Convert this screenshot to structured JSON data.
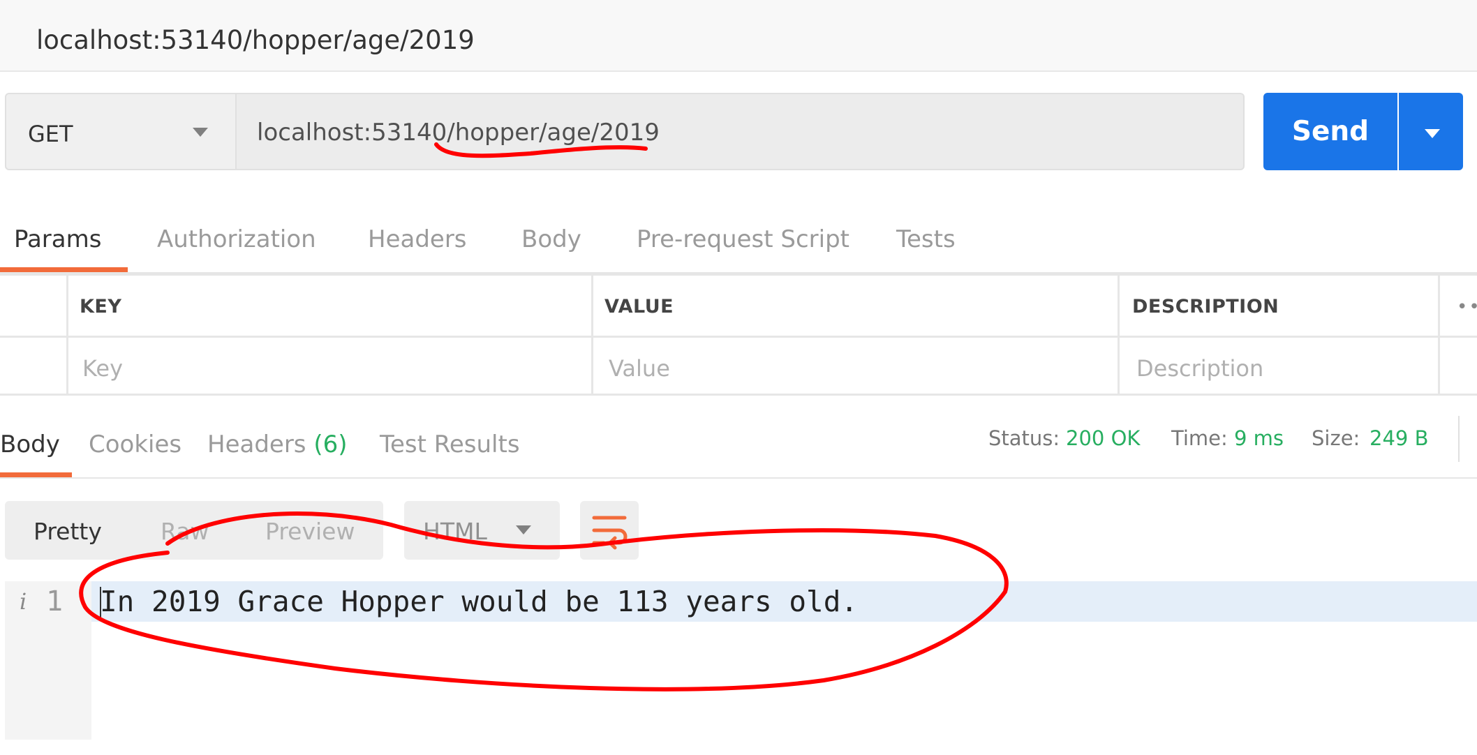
{
  "request": {
    "title": "localhost:53140/hopper/age/2019",
    "method": "GET",
    "url": "localhost:53140/hopper/age/2019",
    "send_label": "Send"
  },
  "request_tabs": [
    "Params",
    "Authorization",
    "Headers",
    "Body",
    "Pre-request Script",
    "Tests"
  ],
  "params_table": {
    "columns": [
      "KEY",
      "VALUE",
      "DESCRIPTION"
    ],
    "placeholders": [
      "Key",
      "Value",
      "Description"
    ],
    "more_label": "••"
  },
  "response": {
    "tabs": {
      "body": "Body",
      "cookies": "Cookies",
      "headers": "Headers",
      "headers_count": "(6)",
      "test_results": "Test Results"
    },
    "status_label": "Status:",
    "status_value": "200 OK",
    "time_label": "Time:",
    "time_value": "9 ms",
    "size_label": "Size:",
    "size_value": "249 B"
  },
  "format_toolbar": {
    "modes": [
      "Pretty",
      "Raw",
      "Preview"
    ],
    "language": "HTML"
  },
  "editor": {
    "info_icon": "i",
    "line_number": "1",
    "line_text": "In 2019 Grace Hopper would be 113 years old."
  },
  "icons": {
    "method_caret": "chevron-down-icon",
    "send_caret": "chevron-down-icon",
    "wrap": "wrap-lines-icon",
    "more": "more-icon"
  },
  "colors": {
    "accent_blue": "#1a75e8",
    "tab_underline": "#f26b3a",
    "status_green": "#27ae60",
    "annotation_red": "#ff0000"
  }
}
